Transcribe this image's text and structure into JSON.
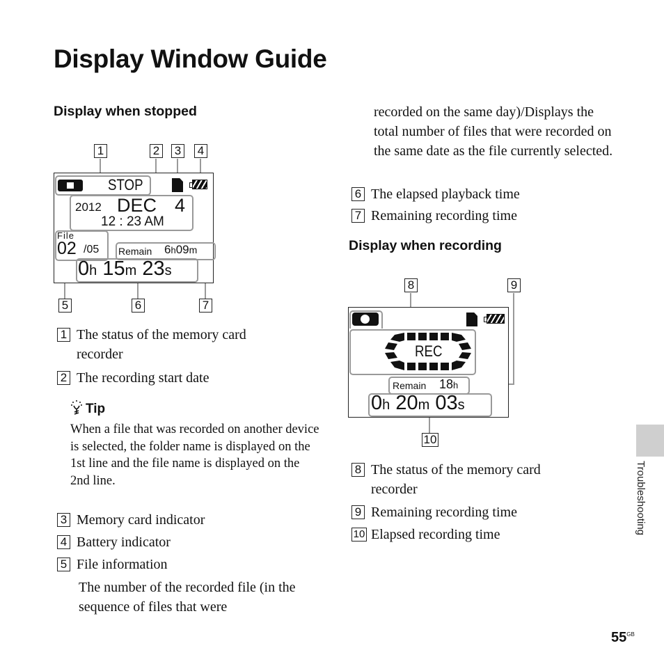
{
  "page": {
    "title": "Display Window Guide",
    "section_tab": "Troubleshooting",
    "page_number": "55",
    "page_suffix": "GB"
  },
  "stopped": {
    "heading": "Display when stopped",
    "callout_numbers": [
      "1",
      "2",
      "3",
      "4",
      "5",
      "6",
      "7"
    ],
    "lcd": {
      "status": "STOP",
      "year": "2012",
      "month": "DEC",
      "day": "4",
      "time": "12 : 23 AM",
      "file_label": "File",
      "file_current": "02",
      "file_total": "/05",
      "remain_label": "Remain",
      "remain_h": "6",
      "remain_h_unit": "h",
      "remain_m": "09",
      "remain_m_unit": "m",
      "elapsed_h": "0",
      "elapsed_h_unit": "h",
      "elapsed_m": "15",
      "elapsed_m_unit": "m",
      "elapsed_s": "23",
      "elapsed_s_unit": "s"
    },
    "items": [
      {
        "num": "1",
        "text": "The status of the memory card recorder"
      },
      {
        "num": "2",
        "text": "The recording start date"
      },
      {
        "num": "3",
        "text": "Memory card indicator"
      },
      {
        "num": "4",
        "text": "Battery indicator"
      },
      {
        "num": "5",
        "text": "File information"
      },
      {
        "num": "6",
        "text": "The elapsed playback time"
      },
      {
        "num": "7",
        "text": "Remaining recording time"
      }
    ],
    "file_info_desc": "The number of the recorded file (in the sequence of files that were recorded on the same day)/Displays the total number of files that were recorded on the same date as the file currently selected.",
    "file_info_desc_left": "The number of the recorded file (in the sequence of files that were",
    "file_info_desc_right": "recorded on the same day)/Displays the total number of files that were recorded on the same date as the file currently selected."
  },
  "tip": {
    "title": "Tip",
    "text": "When a file that was recorded on another device is selected, the folder name is displayed on the 1st line and the file name is displayed on the 2nd line."
  },
  "recording": {
    "heading": "Display when recording",
    "callout_numbers": [
      "8",
      "9",
      "10"
    ],
    "lcd": {
      "status": "REC",
      "remain_label": "Remain",
      "remain_h": "18",
      "remain_h_unit": "h",
      "elapsed_h": "0",
      "elapsed_h_unit": "h",
      "elapsed_m": "20",
      "elapsed_m_unit": "m",
      "elapsed_s": "03",
      "elapsed_s_unit": "s"
    },
    "items": [
      {
        "num": "8",
        "text": "The status of the memory card recorder"
      },
      {
        "num": "9",
        "text": "Remaining recording time"
      },
      {
        "num": "10",
        "text": "Elapsed recording time"
      }
    ]
  }
}
